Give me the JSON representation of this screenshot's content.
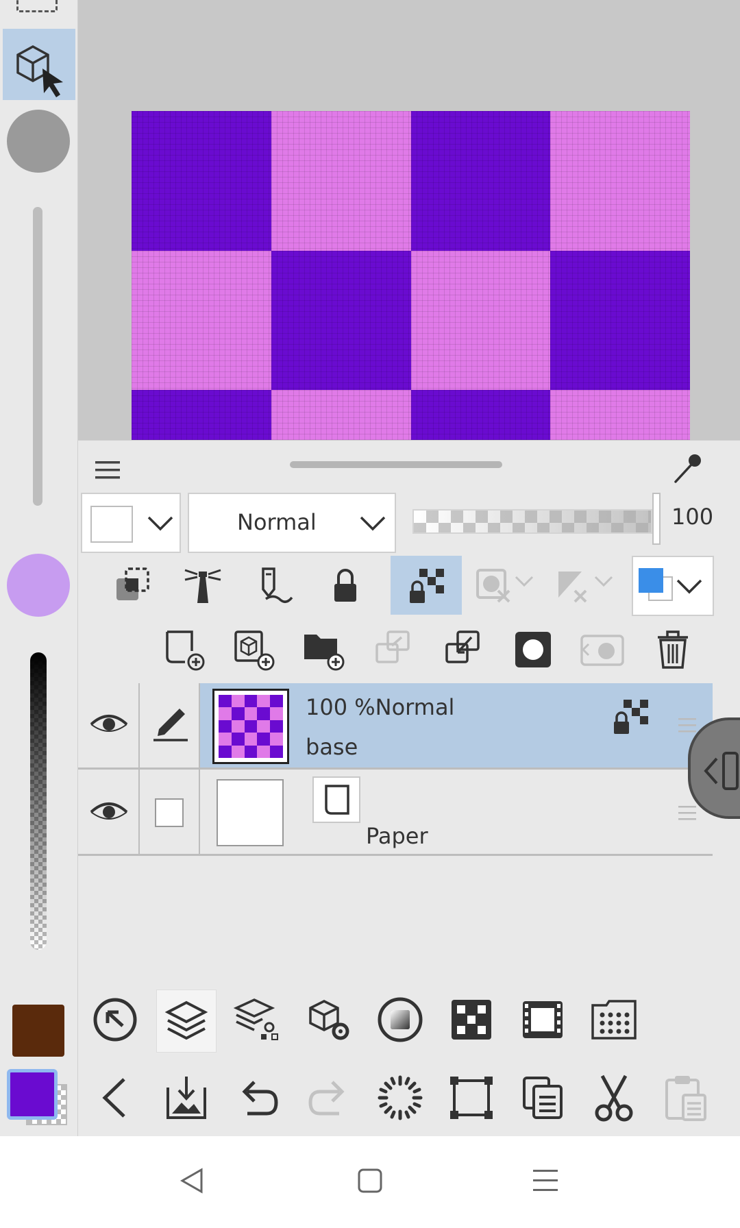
{
  "canvas": {
    "colors": {
      "dark": "#6a0bd0",
      "light": "#e07ae8"
    },
    "grid": [
      [
        "dark",
        "light",
        "dark",
        "light"
      ],
      [
        "light",
        "dark",
        "light",
        "dark"
      ],
      [
        "dark",
        "light",
        "dark",
        "light"
      ]
    ]
  },
  "left_strip": {
    "brush_size_color": "#9a9a9a",
    "brush_color_preview": "#c79cf0",
    "main_color": "#6a0bd0",
    "sub_color": "#5a2a0c"
  },
  "layer_panel": {
    "blend_mode": "Normal",
    "opacity_value": "100",
    "layers": [
      {
        "opacity_mode": "100 %Normal",
        "name": "base"
      },
      {
        "name": "Paper"
      }
    ]
  }
}
